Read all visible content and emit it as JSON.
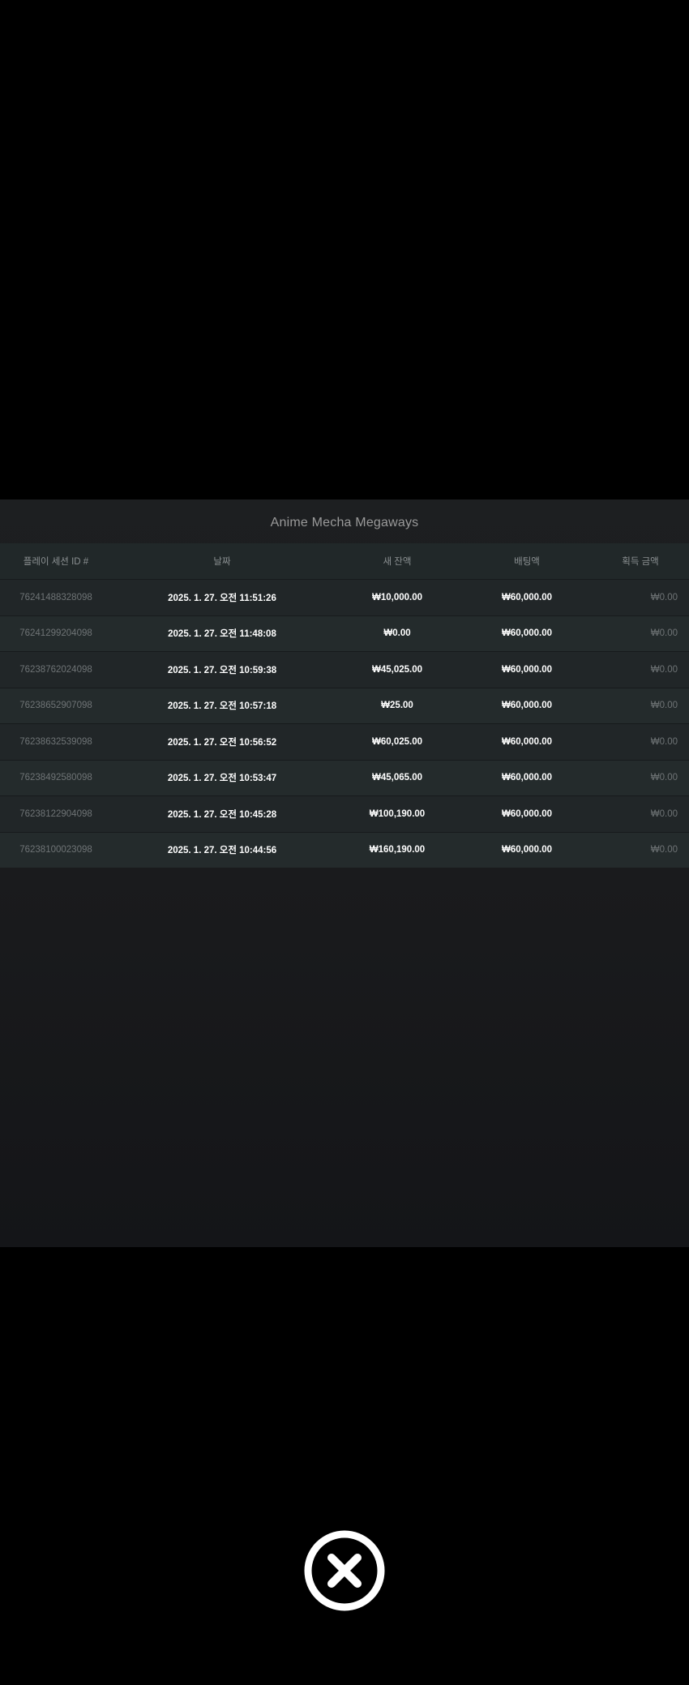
{
  "dialog": {
    "title": "Anime Mecha Megaways"
  },
  "table": {
    "headers": {
      "session_id": "플레이 세션 ID #",
      "date": "날짜",
      "new_balance": "새 잔액",
      "bet_amount": "배팅액",
      "win_amount": "획득 금액"
    },
    "rows": [
      {
        "session_id": "762414883280​98",
        "date": "2025. 1. 27. 오전 11:51:26",
        "new_balance": "₩10,000.00",
        "bet_amount": "₩60,000.00",
        "win_amount": "₩0.00"
      },
      {
        "session_id": "762412992040​98",
        "date": "2025. 1. 27. 오전 11:48:08",
        "new_balance": "₩0.00",
        "bet_amount": "₩60,000.00",
        "win_amount": "₩0.00"
      },
      {
        "session_id": "762387620240​98",
        "date": "2025. 1. 27. 오전 10:59:38",
        "new_balance": "₩45,025.00",
        "bet_amount": "₩60,000.00",
        "win_amount": "₩0.00"
      },
      {
        "session_id": "762386529070​98",
        "date": "2025. 1. 27. 오전 10:57:18",
        "new_balance": "₩25.00",
        "bet_amount": "₩60,000.00",
        "win_amount": "₩0.00"
      },
      {
        "session_id": "762386325390​98",
        "date": "2025. 1. 27. 오전 10:56:52",
        "new_balance": "₩60,025.00",
        "bet_amount": "₩60,000.00",
        "win_amount": "₩0.00"
      },
      {
        "session_id": "762384925800​98",
        "date": "2025. 1. 27. 오전 10:53:47",
        "new_balance": "₩45,065.00",
        "bet_amount": "₩60,000.00",
        "win_amount": "₩0.00"
      },
      {
        "session_id": "762381229040​98",
        "date": "2025. 1. 27. 오전 10:45:28",
        "new_balance": "₩100,190.00",
        "bet_amount": "₩60,000.00",
        "win_amount": "₩0.00"
      },
      {
        "session_id": "762381000230​98",
        "date": "2025. 1. 27. 오전 10:44:56",
        "new_balance": "₩160,190.00",
        "bet_amount": "₩60,000.00",
        "win_amount": "₩0.00"
      }
    ]
  },
  "close_button": {
    "icon": "close-icon"
  }
}
